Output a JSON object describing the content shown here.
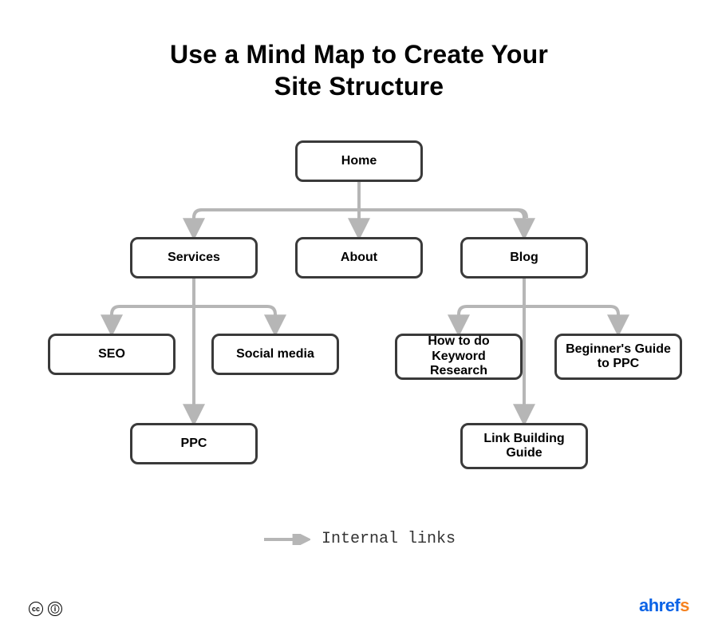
{
  "title": "Use a Mind Map to Create Your\nSite Structure",
  "nodes": {
    "home": "Home",
    "services": "Services",
    "about": "About",
    "blog": "Blog",
    "seo": "SEO",
    "social": "Social media",
    "ppc": "PPC",
    "howto": "How to do Keyword Research",
    "beginners": "Beginner's Guide to PPC",
    "linkbuilding": "Link Building Guide"
  },
  "legend": {
    "label": "Internal links"
  },
  "brand": {
    "a": "ahref",
    "s": "s"
  },
  "colors": {
    "connector": "#b6b6b6",
    "node_border": "#3a3a3a",
    "brand_blue": "#0b63e6",
    "brand_orange": "#f58220"
  }
}
